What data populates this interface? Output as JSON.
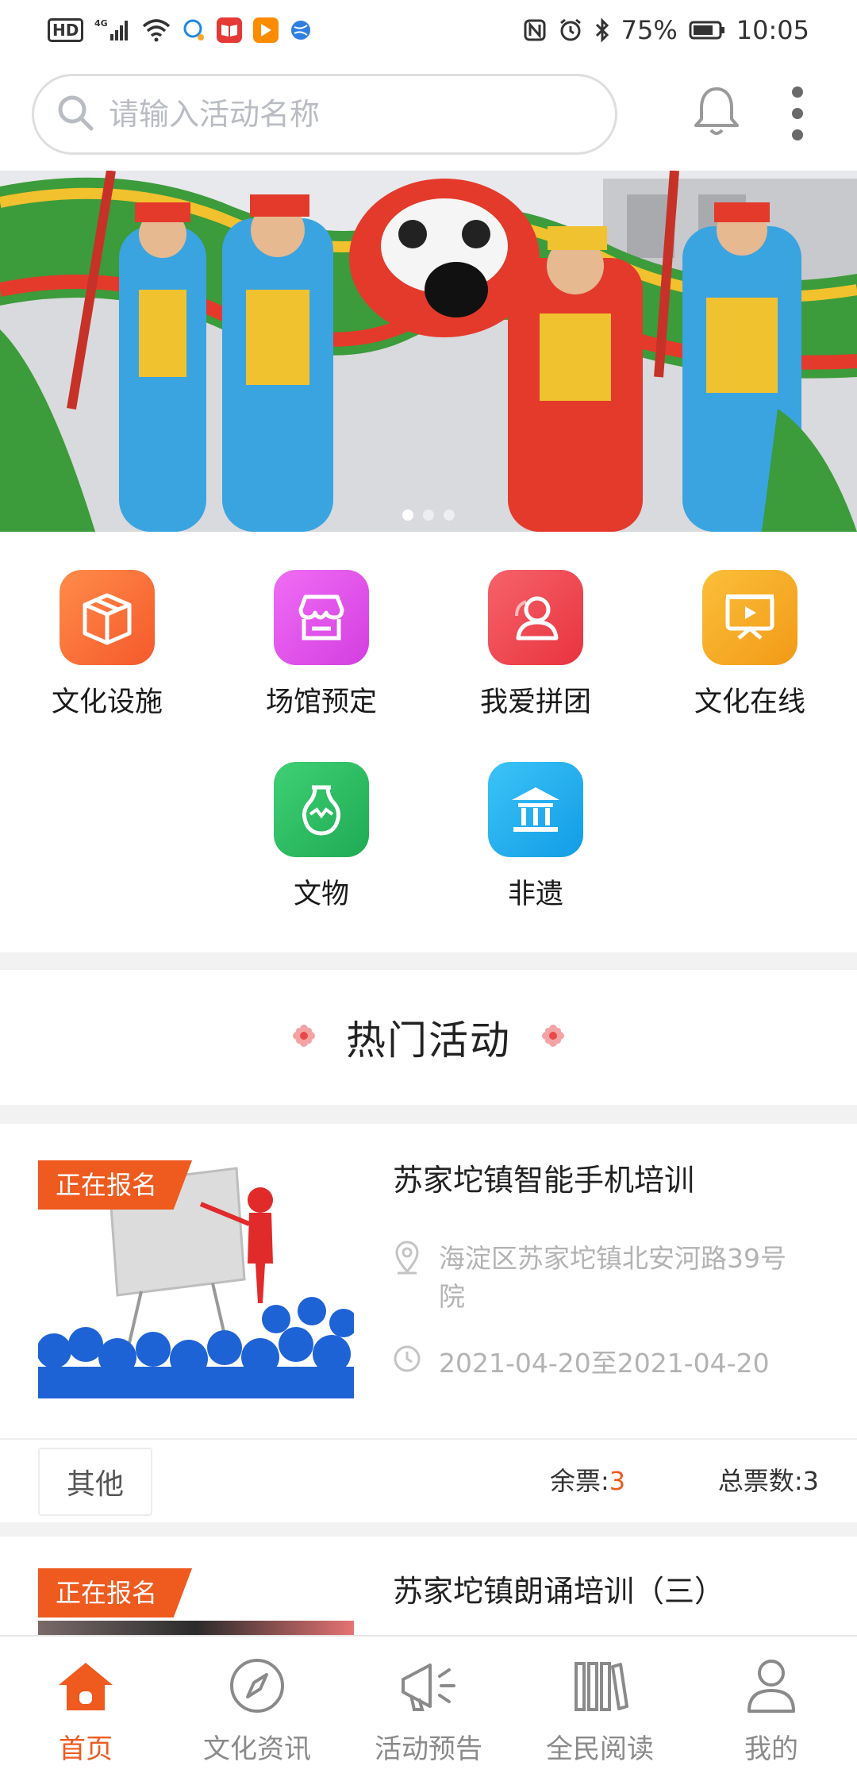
{
  "status_bar": {
    "network_badge": "HD",
    "network_type": "4G",
    "battery": "75%",
    "time": "10:05"
  },
  "search": {
    "placeholder": "请输入活动名称",
    "value": ""
  },
  "banner": {
    "slide_count": 3,
    "active_slide": 1
  },
  "categories": [
    {
      "label": "文化设施",
      "icon": "box-icon",
      "color": "#f96b2f"
    },
    {
      "label": "场馆预定",
      "icon": "shop-icon",
      "color": "#e04fea"
    },
    {
      "label": "我爱拼团",
      "icon": "user-icon",
      "color": "#ef4a55"
    },
    {
      "label": "文化在线",
      "icon": "screen-icon",
      "color": "#f6aa24"
    },
    {
      "label": "文物",
      "icon": "vase-icon",
      "color": "#2cc164"
    },
    {
      "label": "非遗",
      "icon": "museum-icon",
      "color": "#1cb0f0"
    }
  ],
  "section": {
    "title": "热门活动"
  },
  "activities": [
    {
      "status_tag": "正在报名",
      "title": "苏家坨镇智能手机培训",
      "address": "海淀区苏家坨镇北安河路39号院",
      "date_range": "2021-04-20至2021-04-20",
      "type": "其他",
      "remaining_label": "余票:",
      "remaining_value": "3",
      "total_label": "总票数:",
      "total_value": "3"
    },
    {
      "status_tag": "正在报名",
      "title": "苏家坨镇朗诵培训（三）"
    }
  ],
  "bottom_nav": [
    {
      "label": "首页",
      "icon": "home-icon",
      "active": true
    },
    {
      "label": "文化资讯",
      "icon": "compass-icon",
      "active": false
    },
    {
      "label": "活动预告",
      "icon": "megaphone-icon",
      "active": false
    },
    {
      "label": "全民阅读",
      "icon": "books-icon",
      "active": false
    },
    {
      "label": "我的",
      "icon": "person-icon",
      "active": false
    }
  ],
  "colors": {
    "accent": "#ef5a1f",
    "muted_text": "#b3b3b3"
  }
}
